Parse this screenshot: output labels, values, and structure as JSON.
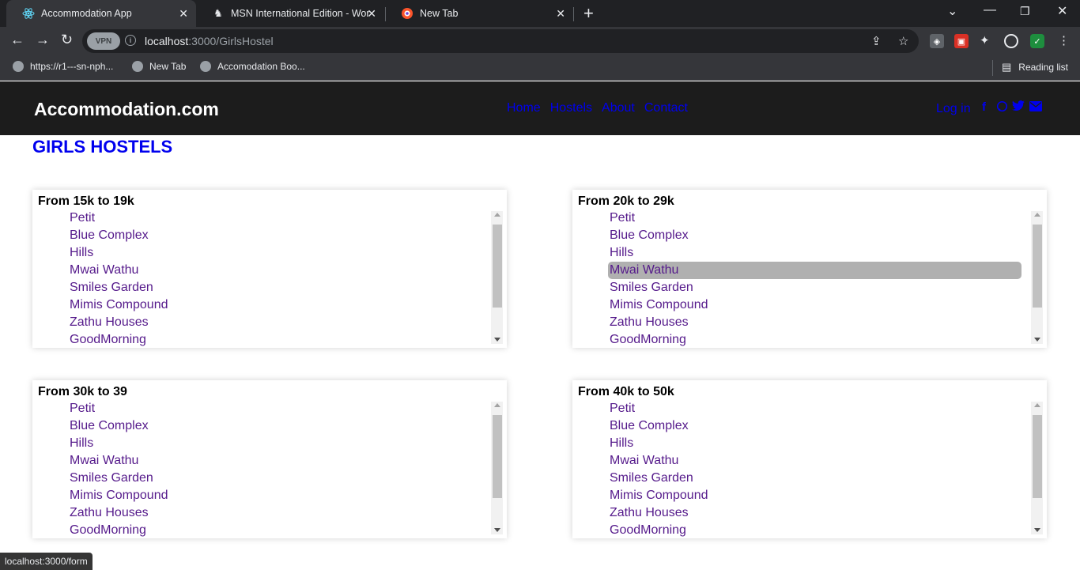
{
  "browser": {
    "tabs": [
      {
        "title": "Accommodation App",
        "icon": "react-icon",
        "active": true
      },
      {
        "title": "MSN International Edition - Worl",
        "icon": "msn-icon",
        "active": false
      },
      {
        "title": "New Tab",
        "icon": "brave-icon",
        "active": false
      }
    ],
    "url_host": "localhost",
    "url_rest": ":3000/GirlsHostel",
    "vpn_label": "VPN",
    "bookmarks": [
      {
        "label": "https://r1---sn-nph..."
      },
      {
        "label": "New Tab"
      },
      {
        "label": "Accomodation Boo..."
      }
    ],
    "reading_list": "Reading list",
    "status_url": "localhost:3000/form"
  },
  "header": {
    "brand": "Accommodation.com",
    "nav": [
      "Home",
      "Hostels",
      "About",
      "Contact"
    ],
    "login": "Log in",
    "social_icons": [
      "facebook-icon",
      "whatsapp-icon",
      "twitter-icon",
      "email-icon"
    ]
  },
  "page_title": "GIRLS HOSTELS",
  "cards": [
    {
      "title": "From 15k to 19k",
      "items": [
        "Petit",
        "Blue Complex",
        "Hills",
        "Mwai Wathu",
        "Smiles Garden",
        "Mimis Compound",
        "Zathu Houses",
        "GoodMorning"
      ],
      "highlighted": null
    },
    {
      "title": "From 20k to 29k",
      "items": [
        "Petit",
        "Blue Complex",
        "Hills",
        "Mwai Wathu",
        "Smiles Garden",
        "Mimis Compound",
        "Zathu Houses",
        "GoodMorning"
      ],
      "highlighted": 3
    },
    {
      "title": "From 30k to 39",
      "items": [
        "Petit",
        "Blue Complex",
        "Hills",
        "Mwai Wathu",
        "Smiles Garden",
        "Mimis Compound",
        "Zathu Houses",
        "GoodMorning"
      ],
      "highlighted": null
    },
    {
      "title": "From 40k to 50k",
      "items": [
        "Petit",
        "Blue Complex",
        "Hills",
        "Mwai Wathu",
        "Smiles Garden",
        "Mimis Compound",
        "Zathu Houses",
        "GoodMorning"
      ],
      "highlighted": null
    }
  ],
  "colors": {
    "link": "#0000ee",
    "visited": "#551a8b",
    "header_bg": "#1c1c1c",
    "highlight": "#b0b0b0"
  }
}
